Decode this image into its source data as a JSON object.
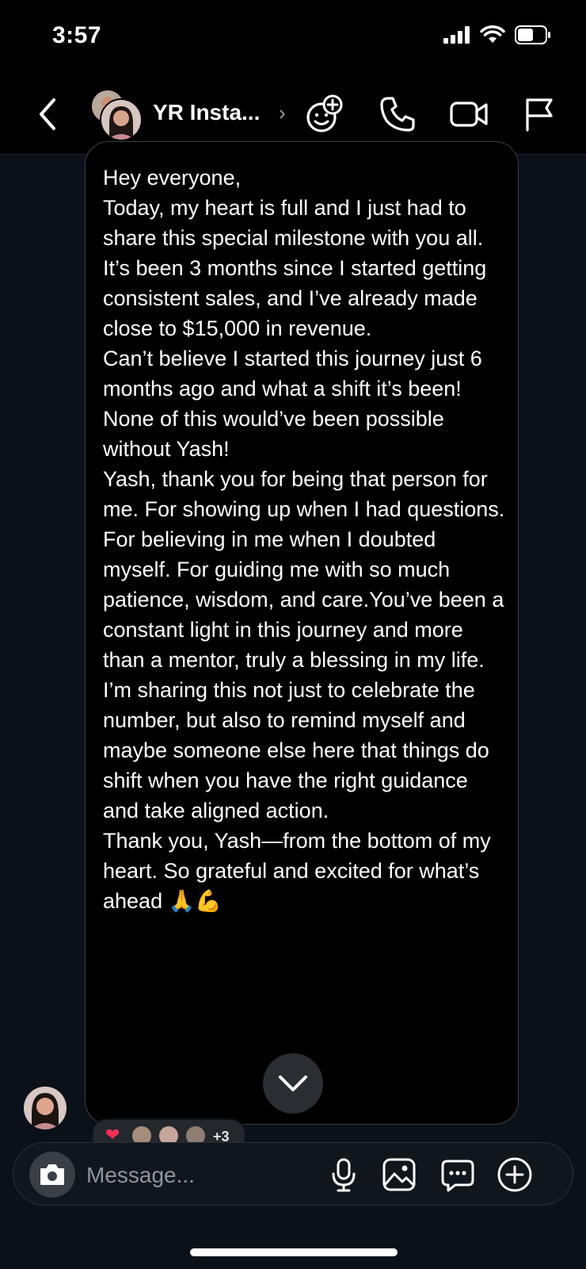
{
  "status": {
    "time": "3:57"
  },
  "header": {
    "title": "YR Insta...",
    "chevron": "›"
  },
  "message": {
    "paragraphs": [
      "Hey everyone,",
      "Today, my heart is full and I just had to share this special milestone with you all.",
      "It’s been 3 months since I started getting consistent sales, and I’ve already made close to $15,000 in revenue.",
      "Can’t believe I started this journey just 6 months ago and what a shift it’s been!",
      "None of this would’ve been possible without Yash!",
      "Yash, thank you for being that person for me. For showing up when I had questions. For believing in me when I doubted myself. For guiding me with so much patience, wisdom, and care.You’ve been a constant light in this journey and more than a mentor, truly a blessing in my life.",
      "I’m sharing this not just to celebrate the number, but also to remind myself and maybe someone else here that things do shift when you have the right guidance and take aligned action.",
      "Thank you, Yash—from the bottom of my heart. So grateful and excited for what’s ahead 🙏💪"
    ]
  },
  "reactions": {
    "heart": "❤",
    "count": "+3"
  },
  "composer": {
    "placeholder": "Message..."
  },
  "icons": {
    "back": "back-icon",
    "add_people": "add-people-icon",
    "call": "phone-icon",
    "video": "video-icon",
    "flag": "flag-icon",
    "camera": "camera-icon",
    "mic": "microphone-icon",
    "gallery": "gallery-icon",
    "sticker": "sticker-icon",
    "plus": "plus-icon",
    "scroll": "chevron-down-icon"
  },
  "colors": {
    "background": "#0b1118",
    "bubble": "#000000",
    "bubble_border": "#3a3f46",
    "heart": "#ff2d55"
  }
}
